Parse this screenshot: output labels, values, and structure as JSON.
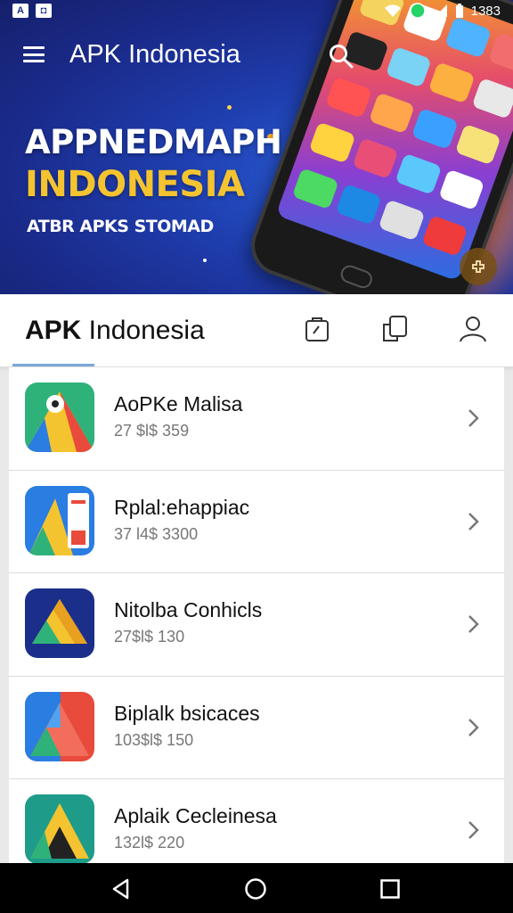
{
  "status_bar": {
    "time": "1383",
    "left_icons": [
      "app-icon-a",
      "app-icon-b"
    ],
    "right_icons": [
      "wifi-icon",
      "whatsapp-icon",
      "signal-icon",
      "battery-icon"
    ]
  },
  "app_bar": {
    "title": "APK Indonesia",
    "menu_icon": "hamburger-icon",
    "search_icon": "search-icon"
  },
  "banner": {
    "title": "APPNEDMAPH",
    "subtitle": "INDONESIA",
    "tagline": "ATBR APKS STOMAD",
    "accent_color": "#f4c430"
  },
  "tab_header": {
    "title_bold": "APK",
    "title_rest": " Indonesia",
    "icons": [
      "clipboard-icon",
      "copy-icon",
      "profile-icon"
    ]
  },
  "apps": [
    {
      "name": "AoPKe Malisa",
      "meta": "27 $l$ 359"
    },
    {
      "name": "Rplal:ehappiac",
      "meta": "37 l4$ 3300"
    },
    {
      "name": "Nitolba Conhicls",
      "meta": "27$l$ 130"
    },
    {
      "name": "Biplalk bsicaces",
      "meta": "103$l$ 150"
    },
    {
      "name": "Aplaik Cecleinesa",
      "meta": "132l$ 220"
    }
  ],
  "nav_bar": {
    "buttons": [
      "back-icon",
      "home-icon",
      "recents-icon"
    ]
  }
}
